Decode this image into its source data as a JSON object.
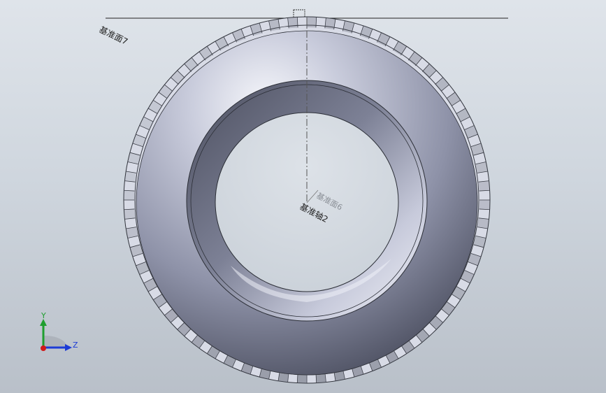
{
  "viewport": {
    "background_top": "#dfe4ea",
    "background_bottom": "#b9c0c9"
  },
  "model": {
    "part": "tire",
    "color": "#b9bdd0",
    "tread_edge_color": "#3a3d46"
  },
  "reference_labels": {
    "plane7": "基准面7",
    "plane_faint": "基准面6",
    "axis2": "基准轴2"
  },
  "triad": {
    "y_label": "Y",
    "z_label": "Z",
    "y_color": "#1f9e2f",
    "z_color": "#1c3bd6",
    "x_color": "#d11a1a"
  }
}
